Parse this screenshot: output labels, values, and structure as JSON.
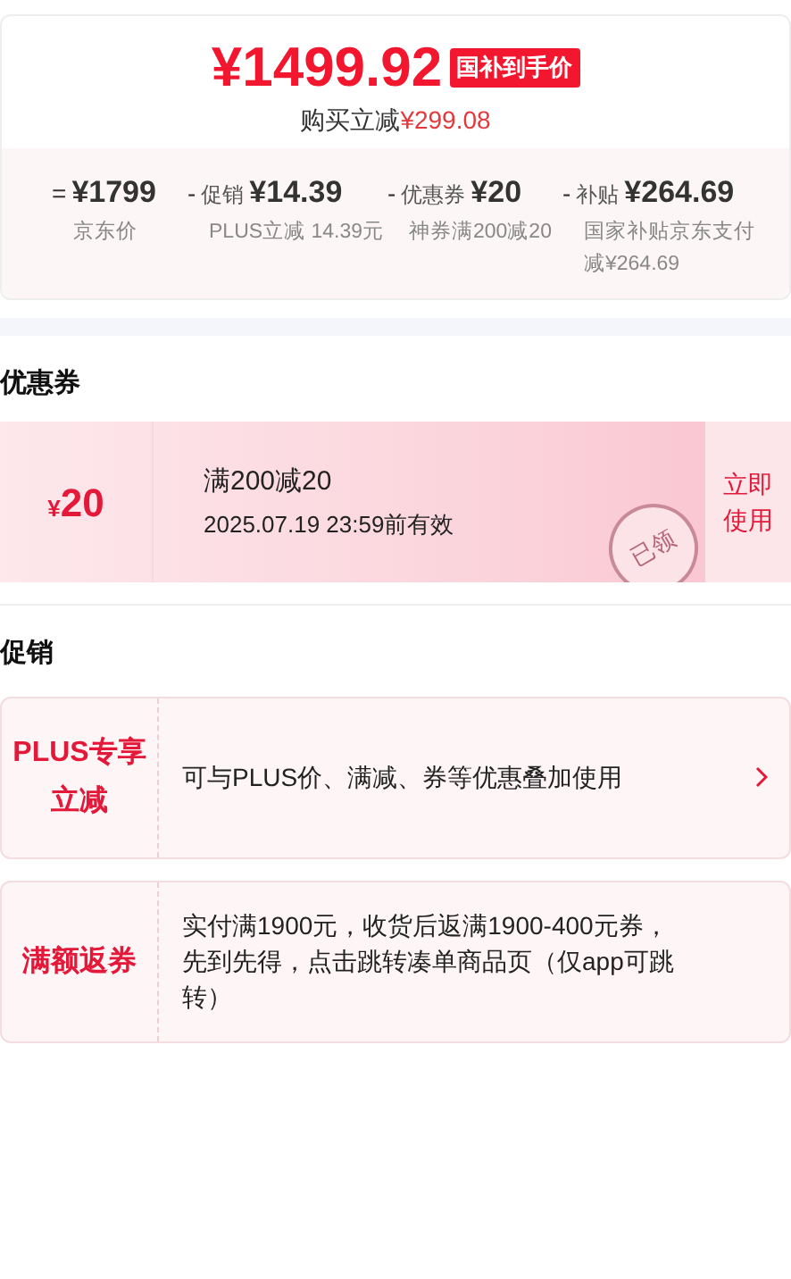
{
  "price": {
    "amount": "¥1499.92",
    "tag": "国补到手价",
    "saving_label": "购买立减",
    "saving_value": "¥299.08"
  },
  "breakdown": [
    {
      "op": "=",
      "value": "¥1799",
      "note": "京东价"
    },
    {
      "op": "-",
      "label": "促销",
      "value": "¥14.39",
      "note": "PLUS立减 14.39元"
    },
    {
      "op": "-",
      "label": "优惠券",
      "value": "¥20",
      "note": "神券满200减20"
    },
    {
      "op": "-",
      "label": "补贴",
      "value": "¥264.69",
      "note": "国家补贴京东支付减¥264.69"
    }
  ],
  "coupons": {
    "title": "优惠券",
    "items": [
      {
        "symbol": "¥",
        "amount": "20",
        "condition": "满200减20",
        "expiry": "2025.07.19 23:59前有效",
        "stamp": "已领",
        "action": "立即使用"
      }
    ]
  },
  "promotions": {
    "title": "促销",
    "items": [
      {
        "label": "PLUS专享立减",
        "text": "可与PLUS价、满减、券等优惠叠加使用",
        "has_arrow": true
      },
      {
        "label": "满额返券",
        "text": "实付满1900元，收货后返满1900-400元券，先到先得，点击跳转凑单商品页（仅app可跳转）",
        "has_arrow": false
      }
    ]
  }
}
